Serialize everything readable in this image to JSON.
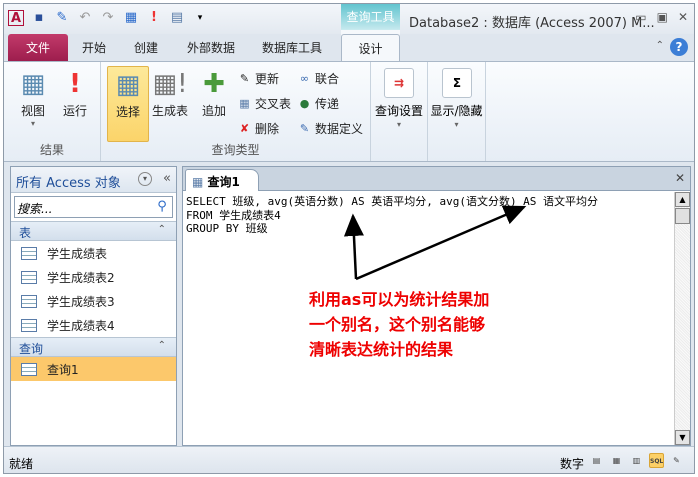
{
  "window": {
    "title": "Database2 : 数据库 (Access 2007) M...",
    "context_tab_group": "查询工具"
  },
  "ribbon_tabs": [
    "文件",
    "开始",
    "创建",
    "外部数据",
    "数据库工具",
    "设计"
  ],
  "groups": {
    "results": {
      "label": "结果",
      "buttons": [
        "视图",
        "运行"
      ]
    },
    "query_type": {
      "label": "查询类型",
      "big": [
        "选择",
        "生成表",
        "追加"
      ],
      "small": [
        "更新",
        "交叉表",
        "删除",
        "联合",
        "传递",
        "数据定义"
      ]
    },
    "setup": {
      "label": "查询设置"
    },
    "showhide": {
      "label": "显示/隐藏"
    }
  },
  "nav": {
    "title": "所有 Access 对象",
    "search_placeholder": "搜索...",
    "sections": [
      {
        "label": "表",
        "items": [
          "学生成绩表",
          "学生成绩表2",
          "学生成绩表3",
          "学生成绩表4"
        ]
      },
      {
        "label": "查询",
        "items": [
          "查询1"
        ]
      }
    ]
  },
  "doc": {
    "tab": "查询1",
    "sql": [
      "SELECT 班级, avg(英语分数) AS 英语平均分, avg(语文分数) AS 语文平均分",
      "FROM 学生成绩表4",
      "GROUP BY 班级"
    ]
  },
  "annotation": [
    "利用as可以为统计结果加",
    "一个别名，这个别名能够",
    "清晰表达统计的结果"
  ],
  "status": {
    "left": "就绪",
    "mode": "数字",
    "view_sql": "SQL"
  }
}
